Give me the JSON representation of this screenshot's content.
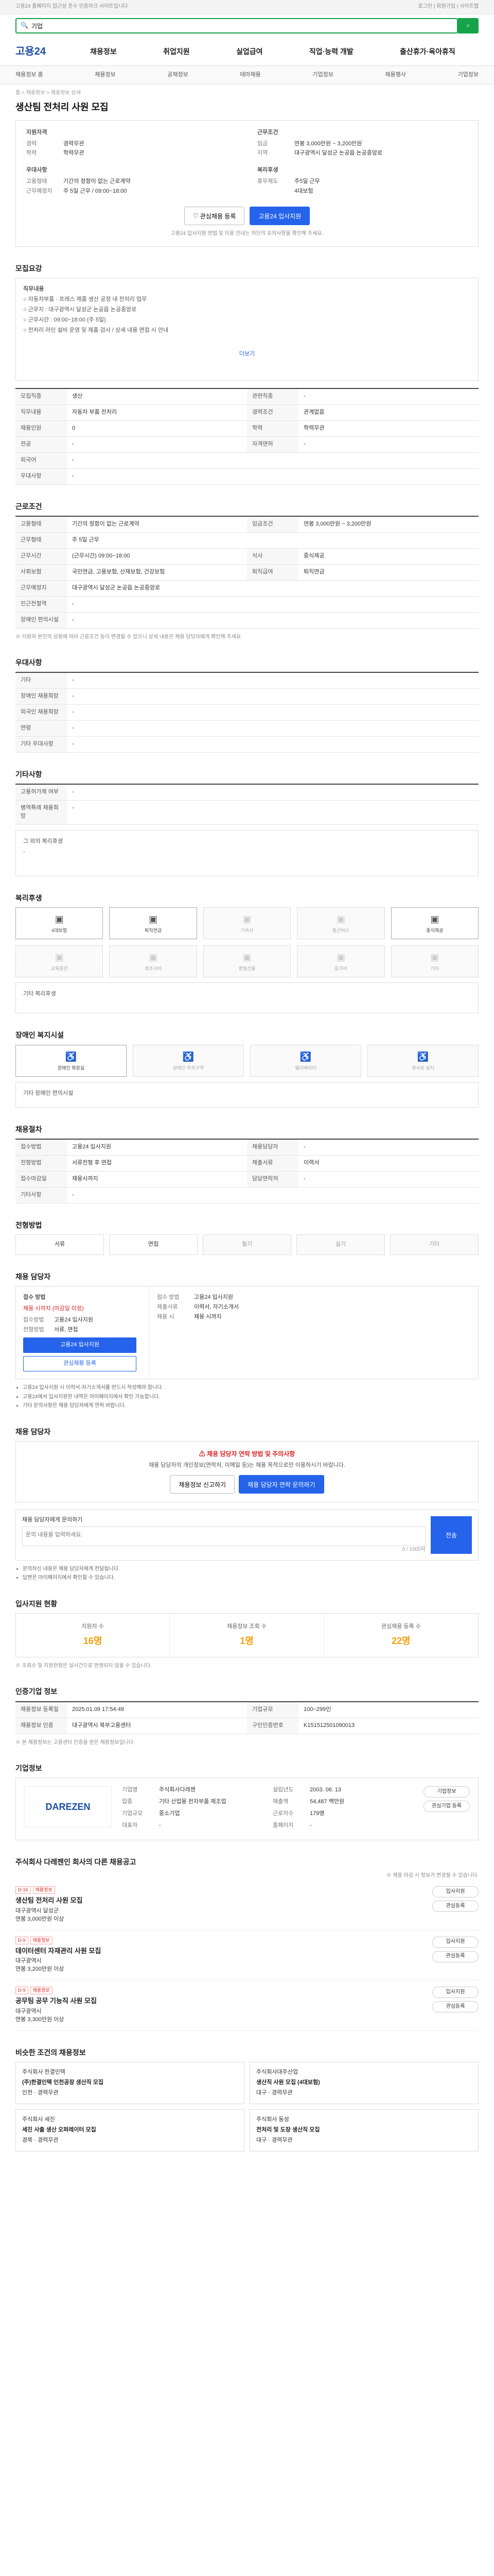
{
  "topbar": {
    "left": "고용24 홈페이지 접근성 준수 인증마크 사이트입니다",
    "right": "로그인 | 회원가입 | 사이트맵"
  },
  "search": {
    "placeholder": "검색어를 입력하세요",
    "value": "기업"
  },
  "gnb": {
    "logo": "고용24",
    "items": [
      "채용정보",
      "취업지원",
      "실업급여",
      "직업·능력 개발",
      "출산휴가·육아휴직"
    ]
  },
  "subnav": {
    "items": [
      "채용정보 홈",
      "채용정보",
      "공채정보",
      "테마채용",
      "기업정보",
      "채용행사",
      "기업정보"
    ]
  },
  "breadcrumb": "홈 > 채용정보 > 채용정보 상세",
  "job": {
    "title": "생산팀 전처리 사원 모집",
    "badge": "채용정보",
    "summary": {
      "left_title": "지원자격",
      "left": [
        [
          "경력",
          "경력무관"
        ],
        [
          "학력",
          "학력무관"
        ]
      ],
      "left2_title": "우대사항",
      "left2": [
        [
          "고용형태",
          "기간의 정함이 없는 근로계약"
        ],
        [
          "근무예정지",
          "주 5일 근무 / 09:00~18:00"
        ]
      ],
      "right_title": "근무조건",
      "right": [
        [
          "임금",
          "연봉 3,000만원 ~ 3,200만원"
        ],
        [
          "지역",
          "대구광역시 달성군 논공읍 논공중앙로"
        ]
      ],
      "right2_title": "복리후생",
      "right2": [
        [
          "휴무제도",
          "주5일 근무"
        ],
        [
          "",
          "4대보험"
        ]
      ]
    },
    "actions": {
      "scrap": "관심채용 등록",
      "apply": "고용24 입사지원"
    },
    "note": "고용24 입사지원 방법 및 이용 안내는 하단의 유의사항을 확인해 주세요."
  },
  "sections": {
    "recruit": "모집요강",
    "conditions": "근로조건",
    "etc": "우대사항",
    "benefits": "기타사항",
    "welfare": "복리후생",
    "disabled": "장애인 복지시설",
    "company_info": "채용절차",
    "process": "전형방법",
    "apply": "채용 담당자",
    "warn": "채용 담당자",
    "qna": "입사지원 현황",
    "info": "인증기업 정보",
    "company": "기업정보",
    "others": "인 회사의 다른 채용공고",
    "similar": "비슷한 조건의 채용정보"
  },
  "recruit_box": [
    "직무내용",
    "○ 자동차부품 · 프레스 제품 생산 공정 내 전처리 업무",
    "○ 근무지 : 대구광역시 달성군 논공읍 논공중앙로",
    "○ 근무시간 : 09:00~18:00 (주 5일)",
    "○ 전처리 라인 설비 운영 및 제품 검사 / 상세 내용 면접 시 안내"
  ],
  "recruit_link": "더보기",
  "recruit_rows": [
    [
      "모집직종",
      "생산",
      "관련직종",
      "-"
    ],
    [
      "직무내용",
      "자동차 부품 전처리",
      "경력조건",
      "관계없음"
    ],
    [
      "채용인원",
      "0",
      "학력",
      "학력무관"
    ],
    [
      "전공",
      "-",
      "자격면허",
      "-"
    ],
    [
      "외국어",
      "-",
      "",
      ""
    ],
    [
      "우대사항",
      "-",
      "",
      ""
    ]
  ],
  "cond_rows": [
    [
      "고용형태",
      "기간의 정함이 없는 근로계약",
      "임금조건",
      "연봉 3,000만원 ~ 3,200만원"
    ],
    [
      "근무형태",
      "주 5일 근무",
      "",
      ""
    ],
    [
      "근무시간",
      "(근무시간) 09:00~18:00",
      "식사",
      "중식제공"
    ],
    [
      "사회보험",
      "국민연금, 고용보험, 산재보험, 건강보험",
      "퇴직급여",
      "퇴직연금"
    ],
    [
      "근무예정지",
      "대구광역시 달성군 논공읍 논공중앙로",
      "",
      ""
    ],
    [
      "인근전철역",
      "-",
      "",
      ""
    ],
    [
      "장애인 편의시설",
      "-",
      "",
      ""
    ]
  ],
  "cond_note": "※ 지원자 본인의 상황에 따라 근로조건 등이 변경될 수 있으니 상세 내용은 채용 담당자에게 확인해 주세요.",
  "etc_rows": [
    [
      "기타",
      "-"
    ],
    [
      "장애인 채용희망",
      "-"
    ],
    [
      "외국인 채용희망",
      "-"
    ],
    [
      "연령",
      "-"
    ],
    [
      "기타 우대사항",
      "-"
    ]
  ],
  "benefit_rows": [
    [
      "고용허가제 여부",
      "-"
    ],
    [
      "병역특례 채용희망",
      "-"
    ]
  ],
  "benefit_box": [
    "그 외의 복리후생",
    "-"
  ],
  "welfare_items": [
    [
      "4대보험",
      true
    ],
    [
      "퇴직연금",
      true
    ],
    [
      "기숙사",
      false
    ],
    [
      "통근버스",
      false
    ],
    [
      "중식제공",
      true
    ],
    [
      "교육훈련",
      false
    ],
    [
      "경조사비",
      false
    ],
    [
      "명절선물",
      false
    ],
    [
      "휴가비",
      false
    ],
    [
      "기타",
      false
    ]
  ],
  "welfare_other": "기타 복리후생",
  "disabled_items": [
    "장애인 화장실",
    "장애인 주차구역",
    "엘리베이터",
    "경사로 설치"
  ],
  "disabled_other": "기타 장애인 편의시설",
  "company_rows": [
    [
      "접수방법",
      "고용24 입사지원",
      "채용담당자",
      "-"
    ],
    [
      "전형방법",
      "서류전형 후 면접",
      "제출서류",
      "이력서"
    ],
    [
      "접수마감일",
      "채용시까지",
      "담당연락처",
      "-"
    ],
    [
      "기타사항",
      "-",
      "",
      ""
    ]
  ],
  "process_steps": [
    "서류",
    "면접",
    "필기",
    "실기",
    "기타"
  ],
  "process_on": [
    true,
    true,
    false,
    false,
    false
  ],
  "apply": {
    "left_title": "접수 방법",
    "deadline_label": "채용 시까지 (마감일 미정)",
    "apply_btn": "고용24 입사지원",
    "scrap_btn": "관심채용 등록",
    "rows": [
      [
        "접수방법",
        "고용24 입사지원"
      ],
      [
        "전형방법",
        "서류, 면접"
      ]
    ],
    "right": [
      [
        "접수 방법",
        "고용24 입사지원"
      ],
      [
        "제출서류",
        "이력서, 자기소개서"
      ],
      [
        "채용 시",
        "채용 시까지"
      ]
    ]
  },
  "apply_notes": [
    "고용24 입사지원 시 이력서·자기소개서를 반드시 작성해야 합니다.",
    "고용24에서 입사지원한 내역은 마이페이지에서 확인 가능합니다.",
    "기타 문의사항은 채용 담당자에게 연락 바랍니다."
  ],
  "warn": {
    "title": "채용 담당자 연락 방법 및 주의사항",
    "text": "채용 담당자의 개인정보(연락처, 이메일 등)는 채용 목적으로만 이용하시기 바랍니다.",
    "btn1": "채용정보 신고하기",
    "btn2": "채용 담당자 연락 문의하기"
  },
  "qna": {
    "label": "채용 담당자에게 문의하기",
    "placeholder": "문의 내용을 입력하세요.",
    "count": "0 / 1000자",
    "submit": "전송"
  },
  "qna_notes": [
    "문의하신 내용은 채용 담당자에게 전달됩니다.",
    "답변은 마이페이지에서 확인할 수 있습니다."
  ],
  "stats": [
    [
      "지원자 수",
      "16명"
    ],
    [
      "채용정보 조회 수",
      "1명"
    ],
    [
      "관심채용 등록 수",
      "22명"
    ]
  ],
  "stats_note": "※ 조회수 및 지원현황은 실시간으로 반영되지 않을 수 있습니다.",
  "info_rows": [
    [
      "채용정보 등록일",
      "2025.01.09 17:54:49",
      "기업규모",
      "100~299인"
    ],
    [
      "채용정보 인증",
      "대구광역시 북부고용센터",
      "구인인증번호",
      "K151512501090013"
    ]
  ],
  "info_note": "※ 본 채용정보는 고용센터 인증을 받은 채용정보입니다.",
  "company": {
    "logo": "DAREZEN",
    "name": "주식회사 다레젠",
    "rows": [
      [
        "기업명",
        "주식회사다레젠",
        "설립년도",
        "2003. 06. 13"
      ],
      [
        "업종",
        "기타 산업용 전자부품 제조업",
        "매출액",
        "54,487 백만원"
      ],
      [
        "기업규모",
        "중소기업",
        "근로자수",
        "179명"
      ],
      [
        "대표자",
        "-",
        "홈페이지",
        "-"
      ]
    ],
    "btn1": "기업정보",
    "btn2": "관심기업 등록"
  },
  "others_note": "※ 채용 마감 시 정보가 변경될 수 있습니다.",
  "others": [
    {
      "date": "D-16",
      "tag": "채용정보",
      "title": "생산팀 전처리 사원 모집",
      "company": "대구광역시 달성군",
      "meta": "연봉 3,000만원 이상",
      "b1": "입사지원",
      "b2": "관심등록"
    },
    {
      "date": "D-9",
      "tag": "채용정보",
      "title": "데이터센터 자재관리 사원 모집",
      "company": "대구광역시",
      "meta": "연봉 3,200만원 이상",
      "b1": "입사지원",
      "b2": "관심등록"
    },
    {
      "date": "D-9",
      "tag": "채용정보",
      "title": "공무팀 공무 기능직 사원 모집",
      "company": "대구광역시",
      "meta": "연봉 3,300만원 이상",
      "b1": "입사지원",
      "b2": "관심등록"
    }
  ],
  "similar": [
    {
      "company": "주식회사 한결인텍",
      "title": "(주)한결인텍 인천공장 생산직 모집",
      "meta": "인천 · 경력무관"
    },
    {
      "company": "주식회사대주산업",
      "title": "생산직 사원 모집 (4대보험)",
      "meta": "대구 · 경력무관"
    },
    {
      "company": "주식회사 세진",
      "title": "세진 사출 생산 오퍼레이터 모집",
      "meta": "경북 · 경력무관"
    },
    {
      "company": "주식회사 동성",
      "title": "전처리 및 도장 생산직 모집",
      "meta": "대구 · 경력무관"
    }
  ]
}
